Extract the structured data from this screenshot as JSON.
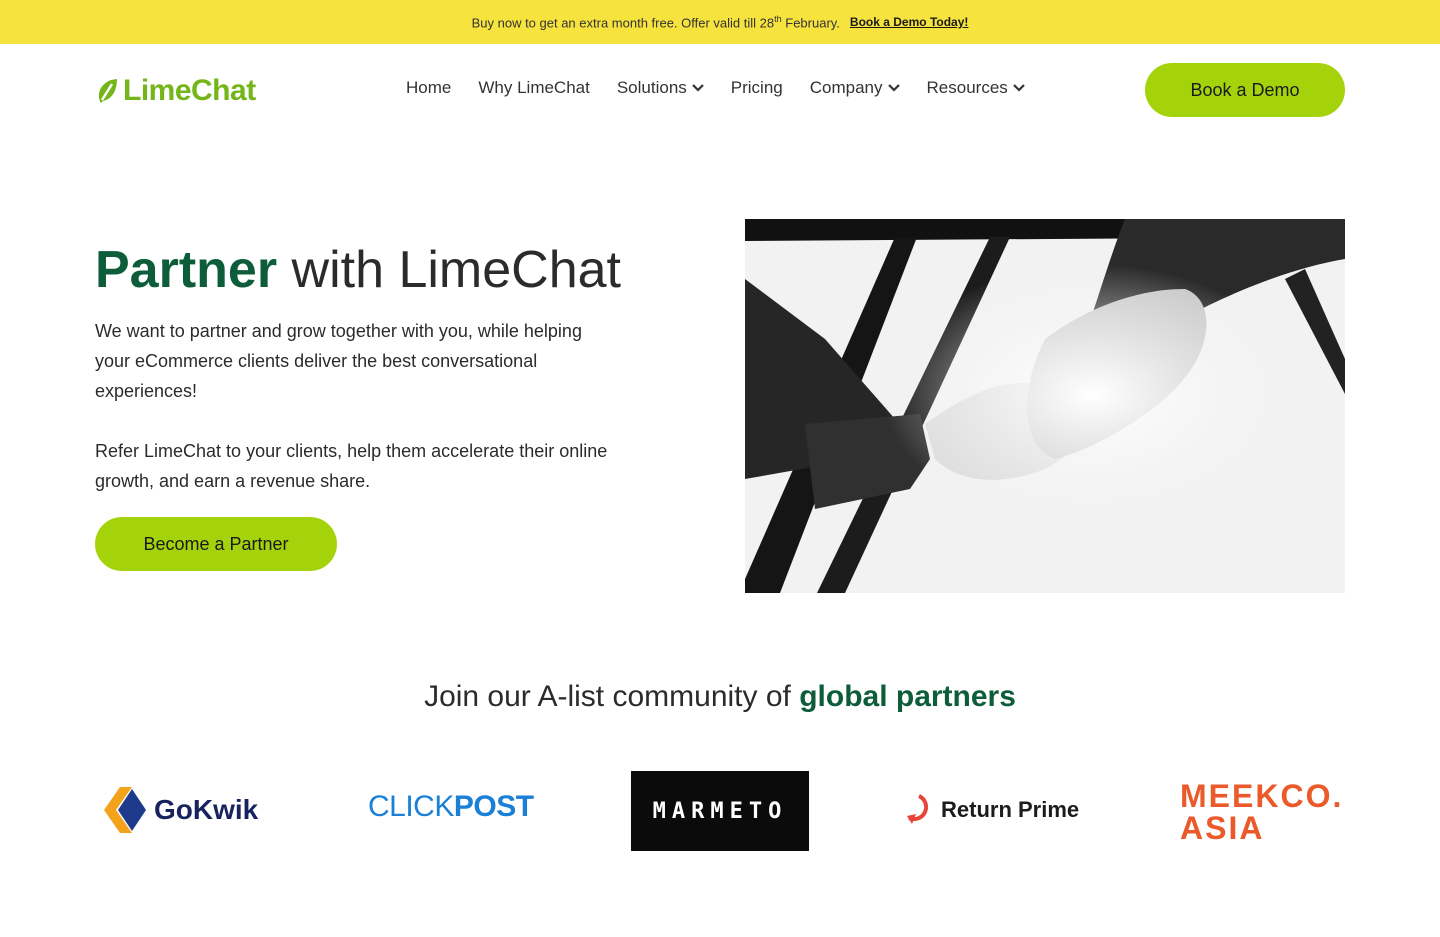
{
  "banner": {
    "message_pre": "Buy now to get an extra month free. Offer valid till 28",
    "message_sup": "th",
    "message_post": " February.",
    "cta": "Book a Demo Today!"
  },
  "brand": {
    "name": "LimeChat"
  },
  "nav": {
    "items": [
      {
        "label": "Home"
      },
      {
        "label": "Why LimeChat"
      },
      {
        "label": "Solutions"
      },
      {
        "label": "Pricing"
      },
      {
        "label": "Company"
      },
      {
        "label": "Resources"
      }
    ]
  },
  "header": {
    "cta": "Book a Demo"
  },
  "hero": {
    "title_strong": "Partner",
    "title_rest": " with LimeChat",
    "paragraph1": "We want to partner and grow together with you, while helping your eCommerce clients deliver the best conversational experiences!",
    "paragraph2": "Refer LimeChat to your clients, help them accelerate their online growth, and earn a revenue share.",
    "cta": "Become a Partner"
  },
  "partners": {
    "heading_pre": "Join our A-list community of ",
    "heading_strong": "global partners",
    "logos": [
      {
        "name": "GoKwik"
      },
      {
        "name_light": "CLICK",
        "name_bold": "POST"
      },
      {
        "name": "MARMETO"
      },
      {
        "name": "Return Prime"
      },
      {
        "line1": "MEEKCO.",
        "line2": "ASIA"
      }
    ]
  },
  "colors": {
    "banner_bg": "#f7e33e",
    "accent_lime": "#a5d30b",
    "brand_green": "#74b51a",
    "heading_green": "#0d5c3a"
  }
}
